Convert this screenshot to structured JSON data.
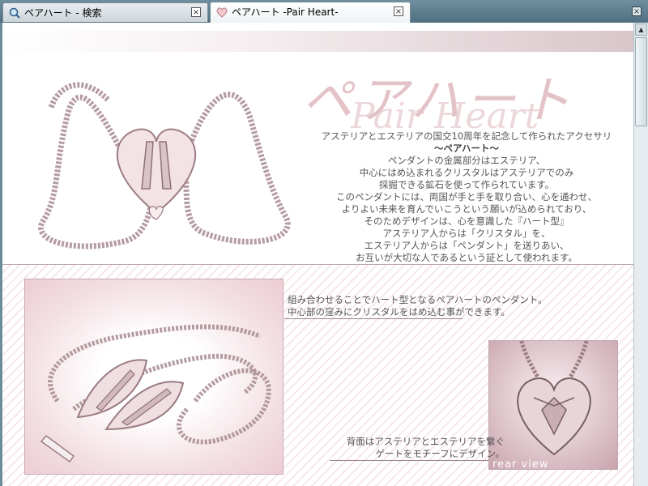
{
  "tabs": [
    {
      "label": "ペアハート - 検索",
      "icon": "search-icon"
    },
    {
      "label": "ペアハート -Pair Heart-",
      "icon": "heart-icon"
    }
  ],
  "close_glyph": "×",
  "logo": {
    "japanese": "ペアハート",
    "english": "Pair Heart"
  },
  "description": [
    "アステリアとエステリアの国交10周年を記念して作られたアクセサリ",
    "～ペアハート～",
    "ペンダントの金属部分はエステリア、",
    "中心にはめ込まれるクリスタルはアステリアでのみ",
    "採掘できる鉱石を使って作られています。",
    "このペンダントには、両国が手と手を取り合い、心を通わせ、",
    "よりよい未来を育んでいこうという願いが込められており、",
    "そのためデザインは、心を意識した『ハート型』",
    "アステリア人からは「クリスタル」を、",
    "エステリア人からは「ペンダント」を送りあい、",
    "お互いが大切な人であるという証として使われます。"
  ],
  "caption_top": [
    "組み合わせることでハート型となるペアハートのペンダント。",
    "中心部の窪みにクリスタルをはめ込む事ができます。"
  ],
  "caption_bottom": [
    "背面はアステリアとエステリアを繋ぐ",
    "ゲートをモチーフにデザイン。"
  ],
  "rear_label": "rear view",
  "colors": {
    "accent": "#e4c3c8",
    "tabbar": "#5a7888",
    "text": "#555555"
  }
}
